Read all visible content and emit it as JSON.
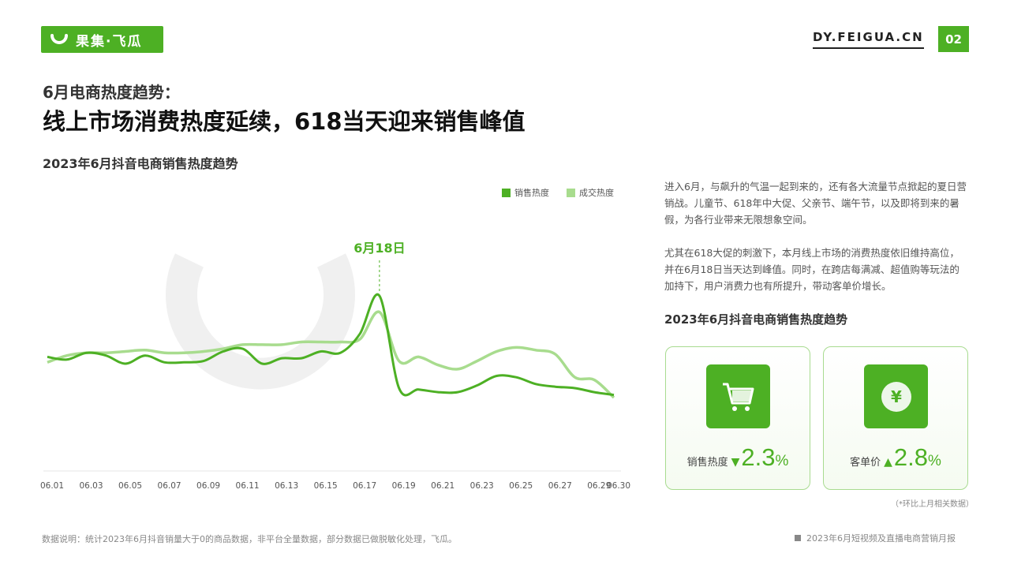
{
  "brand": {
    "logo_text": "果集·飞瓜",
    "site": "DY.FEIGUA.CN",
    "page_number": "02",
    "accent": "#4db024"
  },
  "header": {
    "kicker": "6月电商热度趋势：",
    "headline": "线上市场消费热度延续，618当天迎来销售峰值"
  },
  "chart_section": {
    "title": "2023年6月抖音电商销售热度趋势"
  },
  "chart_data": {
    "type": "line",
    "title": "2023年6月抖音电商销售热度趋势",
    "x_tick_labels": [
      "06.01",
      "06.03",
      "06.05",
      "06.07",
      "06.09",
      "06.11",
      "06.13",
      "06.15",
      "06.17",
      "06.19",
      "06.21",
      "06.23",
      "06.25",
      "06.27",
      "06.29",
      "06.30"
    ],
    "x": [
      "06.01",
      "06.02",
      "06.03",
      "06.04",
      "06.05",
      "06.06",
      "06.07",
      "06.08",
      "06.09",
      "06.10",
      "06.11",
      "06.12",
      "06.13",
      "06.14",
      "06.15",
      "06.16",
      "06.17",
      "06.18",
      "06.19",
      "06.20",
      "06.21",
      "06.22",
      "06.23",
      "06.24",
      "06.25",
      "06.26",
      "06.27",
      "06.28",
      "06.29",
      "06.30"
    ],
    "series": [
      {
        "name": "销售热度",
        "color": "#4db024",
        "values": [
          55,
          53,
          58,
          56,
          50,
          56,
          51,
          51,
          52,
          59,
          61,
          50,
          54,
          54,
          59,
          58,
          72,
          100,
          32,
          31,
          29,
          29,
          34,
          41,
          40,
          35,
          33,
          32,
          29,
          27
        ]
      },
      {
        "name": "成交热度",
        "color": "#a8dc8e",
        "values": [
          51,
          56,
          58,
          58,
          59,
          60,
          58,
          58,
          59,
          61,
          64,
          64,
          64,
          66,
          66,
          66,
          68,
          88,
          52,
          55,
          49,
          46,
          52,
          59,
          62,
          60,
          57,
          40,
          38,
          25
        ]
      }
    ],
    "ylim": [
      0,
      100
    ],
    "grid": false,
    "legend": "top-right",
    "annotation": {
      "x": "06.18",
      "label": "6月18日"
    }
  },
  "description": {
    "p1": "进入6月，与飙升的气温一起到来的，还有各大流量节点掀起的夏日营销战。儿童节、618年中大促、父亲节、端午节，以及即将到来的暑假，为各行业带来无限想象空间。",
    "p2": "尤其在618大促的刺激下，本月线上市场的消费热度依旧维持高位，并在6月18日当天达到峰值。同时，在跨店每满减、超值购等玩法的加持下，用户消费力也有所提升，带动客单价增长。"
  },
  "right_section": {
    "title": "2023年6月抖音电商销售热度趋势"
  },
  "cards": [
    {
      "label": "销售热度",
      "arrow": "▼",
      "value": "2.3",
      "unit": "%",
      "icon": "shopping-cart-icon"
    },
    {
      "label": "客单价",
      "arrow": "▲",
      "value": "2.8",
      "unit": "%",
      "icon": "yuan-coin-icon"
    }
  ],
  "note": "（*环比上月相关数据）",
  "footer": {
    "left": "数据说明：统计2023年6月抖音销量大于0的商品数据，非平台全量数据，部分数据已做脱敏化处理，飞瓜。",
    "right": "2023年6月短视频及直播电商营销月报"
  }
}
